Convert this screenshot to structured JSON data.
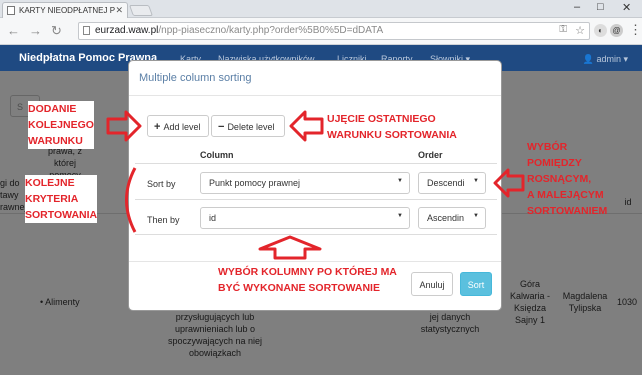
{
  "browser": {
    "tab_title": "KARTY NIEODPŁATNEJ P",
    "url_host": "eurzad.waw.pl",
    "url_path": "/npp-piaseczno/karty.php?order%5B0%5D=dDATA"
  },
  "navbar": {
    "brand": "Niedpłatna Pomoc Prawna",
    "links": [
      "Karty",
      "Nazwiska użytkowników",
      "Liczniki",
      "Raporty",
      "Słowniki ▾"
    ],
    "admin": "admin ▾"
  },
  "background": {
    "search_placeholder": "S",
    "col_fragment_1": "Udzielana\nprawa, z której\npomocy",
    "col_fragment_2": "gi do\ntawy\nrawnej",
    "col_id": "id",
    "cell_alimenty": "• Alimenty",
    "cell_long_text": "przysługujących lub\nuprawnieniach lub o\nspoczywających na niej\nobowiązkach",
    "cell_stats": "jej danych\nstatystycznych",
    "cell_place": "Góra\nKalwaria -\nKsiędza\nSajny 1",
    "cell_person": "Magdalena\nTylipska",
    "cell_id": "1030"
  },
  "modal": {
    "title": "Multiple column sorting",
    "add_level": "Add level",
    "delete_level": "Delete level",
    "col_header_column": "Column",
    "col_header_order": "Order",
    "rows": [
      {
        "label": "Sort by",
        "column": "Punkt pomocy prawnej",
        "order": "Descendi"
      },
      {
        "label": "Then by",
        "column": "id",
        "order": "Ascendin"
      }
    ],
    "cancel": "Anuluj",
    "sort": "Sort"
  },
  "annotations": {
    "add_level": [
      "DODANIE",
      "KOLEJNEGO",
      "WARUNKU"
    ],
    "delete_level": [
      "UJĘCIE OSTATNIEGO",
      "WARUNKU SORTOWANIA"
    ],
    "criteria": [
      "KOLEJNE",
      "KRYTERIA",
      "SORTOWANIA"
    ],
    "order_choice": [
      "WYBÓR",
      "POMIĘDZY",
      "ROSNĄCYM,",
      "A MALEJĄCYM",
      "SORTOWANIEM"
    ],
    "column_choice": [
      "WYBÓR KOLUMNY PO KTÓREJ MA",
      "BYĆ WYKONANE SORTOWANIE"
    ]
  },
  "colors": {
    "navbar": "#1f4a82",
    "annotation": "#e3252b",
    "sort_button": "#5bc0de"
  }
}
